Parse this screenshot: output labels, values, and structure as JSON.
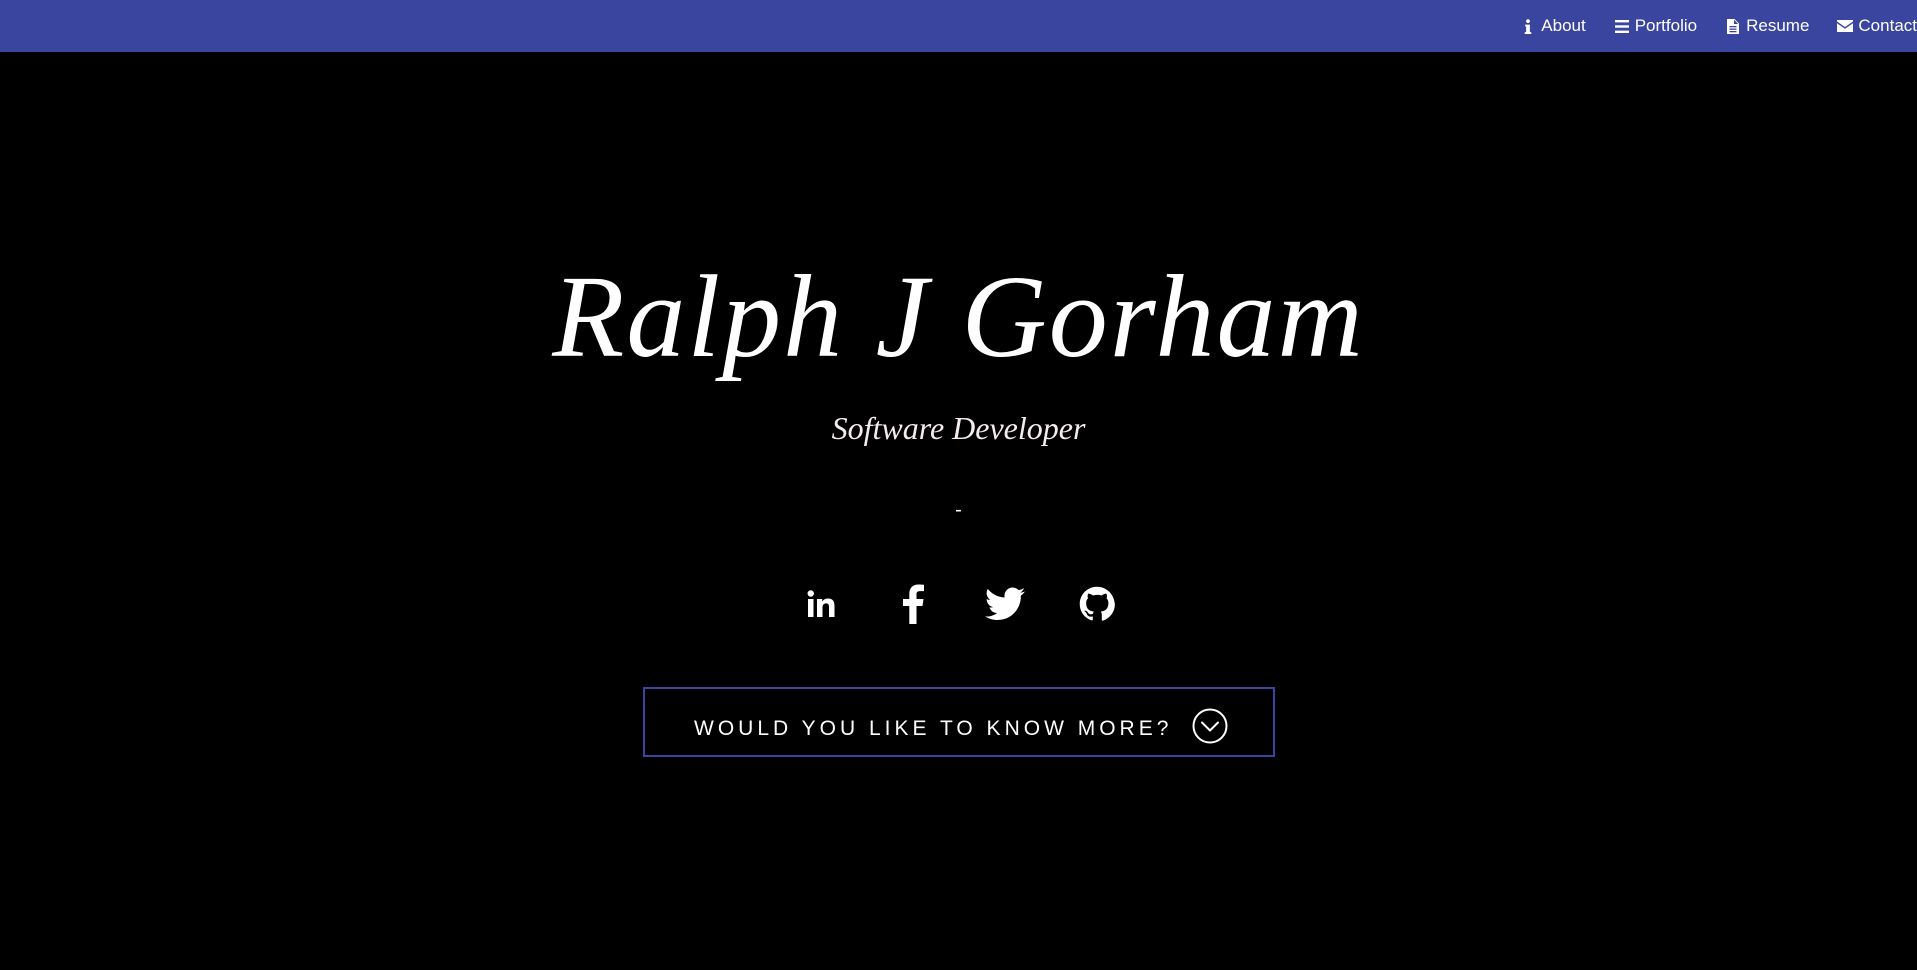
{
  "nav": {
    "items": [
      {
        "label": "About",
        "icon": "info-icon"
      },
      {
        "label": "Portfolio",
        "icon": "bars-icon"
      },
      {
        "label": "Resume",
        "icon": "document-icon"
      },
      {
        "label": "Contact",
        "icon": "envelope-icon"
      }
    ],
    "background": "#3a45a0"
  },
  "hero": {
    "name": "Ralph J Gorham",
    "subtitle": "Software Developer",
    "divider": "-",
    "socials": [
      {
        "icon": "linkedin-icon"
      },
      {
        "icon": "facebook-icon"
      },
      {
        "icon": "twitter-icon"
      },
      {
        "icon": "github-icon"
      }
    ],
    "more_button": {
      "label": "WOULD YOU LIKE TO KNOW MORE?",
      "icon": "chevron-down-circle-icon"
    }
  },
  "colors": {
    "background": "#000000",
    "accent": "#3a45a0",
    "text": "#ffffff"
  }
}
